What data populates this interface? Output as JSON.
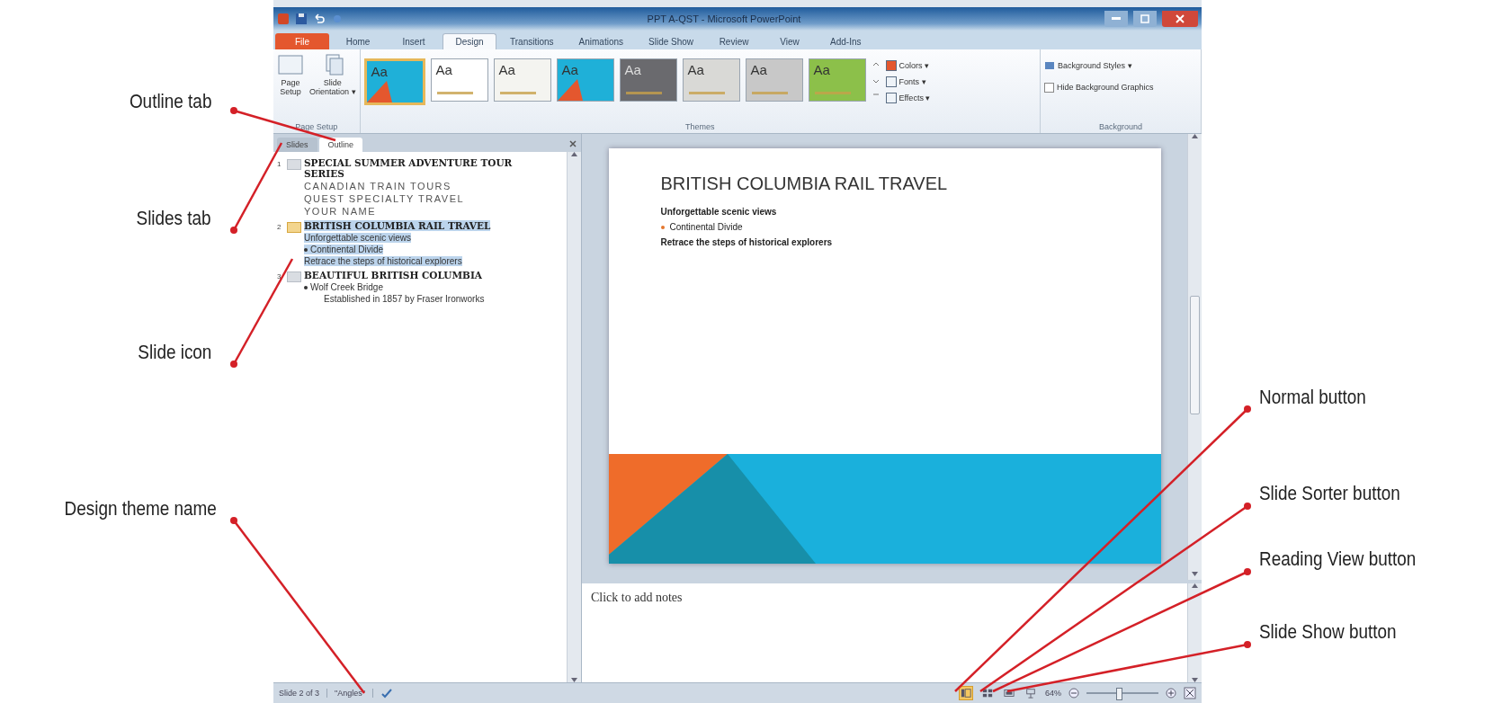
{
  "window": {
    "title": "PPT A-QST - Microsoft PowerPoint"
  },
  "ribbon_tabs": [
    {
      "label": "File",
      "selected": false,
      "kind": "file"
    },
    {
      "label": "Home",
      "selected": false,
      "kind": "tab"
    },
    {
      "label": "Insert",
      "selected": false,
      "kind": "tab"
    },
    {
      "label": "Design",
      "selected": true,
      "kind": "tab"
    },
    {
      "label": "Transitions",
      "selected": false,
      "kind": "tab"
    },
    {
      "label": "Animations",
      "selected": false,
      "kind": "tab"
    },
    {
      "label": "Slide Show",
      "selected": false,
      "kind": "tab"
    },
    {
      "label": "Review",
      "selected": false,
      "kind": "tab"
    },
    {
      "label": "View",
      "selected": false,
      "kind": "tab"
    },
    {
      "label": "Add-Ins",
      "selected": false,
      "kind": "tab"
    }
  ],
  "page_setup": {
    "buttons": [
      "Page\nSetup",
      "Slide\nOrientation ▾"
    ],
    "group": "Page Setup"
  },
  "themes": {
    "group": "Themes",
    "items": [
      {
        "label": "Aa",
        "selected": true,
        "color": "#1fb0d8"
      },
      {
        "label": "Aa",
        "selected": false,
        "color": "#ffffff"
      },
      {
        "label": "Aa",
        "selected": false,
        "color": "#f4f4f0"
      },
      {
        "label": "Aa",
        "selected": false,
        "color": "#1fb0d8"
      },
      {
        "label": "Aa",
        "selected": false,
        "color": "#6a6a6e"
      },
      {
        "label": "Aa",
        "selected": false,
        "color": "#d9d9d6"
      },
      {
        "label": "Aa",
        "selected": false,
        "color": "#c8c8c8"
      },
      {
        "label": "Aa",
        "selected": false,
        "color": "#8cc04a"
      }
    ],
    "options": [
      "Colors ▾",
      "Fonts ▾",
      "Effects ▾"
    ]
  },
  "background": {
    "group": "Background",
    "styles": "Background Styles ▾",
    "hide_graphics": {
      "label": "Hide Background Graphics",
      "checked": false
    }
  },
  "pane_tabs": [
    {
      "label": "Slides",
      "selected": false
    },
    {
      "label": "Outline",
      "selected": true
    }
  ],
  "outline": [
    {
      "number": "1",
      "title": "SPECIAL SUMMER ADVENTURE TOUR SERIES",
      "selected": false,
      "lines": [
        {
          "text": "CANADIAN TRAIN TOURS",
          "kind": "spaced"
        },
        {
          "text": "QUEST SPECIALTY TRAVEL",
          "kind": "spaced"
        },
        {
          "text": "YOUR NAME",
          "kind": "spaced"
        }
      ]
    },
    {
      "number": "2",
      "title": "BRITISH COLUMBIA RAIL TRAVEL",
      "selected": true,
      "lines": [
        {
          "text": "Unforgettable scenic views",
          "kind": "plain"
        },
        {
          "text": "Continental Divide",
          "kind": "bullet"
        },
        {
          "text": "Retrace the steps of historical explorers",
          "kind": "plain"
        }
      ]
    },
    {
      "number": "3",
      "title": "BEAUTIFUL BRITISH COLUMBIA",
      "selected": false,
      "lines": [
        {
          "text": "Wolf Creek Bridge",
          "kind": "bullet"
        },
        {
          "text": "Established in 1857 by Fraser Ironworks",
          "kind": "sub"
        }
      ]
    }
  ],
  "slide": {
    "title": "BRITISH COLUMBIA RAIL TRAVEL",
    "lines": [
      {
        "text": "Unforgettable scenic views",
        "kind": "plain"
      },
      {
        "text": "Continental Divide",
        "kind": "bullet"
      },
      {
        "text": "Retrace the steps of historical explorers",
        "kind": "plain"
      }
    ]
  },
  "notes": {
    "placeholder": "Click to add notes"
  },
  "status_bar": {
    "slide": "Slide 2 of 3",
    "theme": "\"Angles\"",
    "views": [
      {
        "kind": "normal",
        "selected": true
      },
      {
        "kind": "sorter",
        "selected": false
      },
      {
        "kind": "reading",
        "selected": false
      },
      {
        "kind": "show",
        "selected": false
      }
    ],
    "zoom": "64%",
    "zoom_level": {
      "level": 0.45
    }
  },
  "callouts": [
    {
      "label": "Outline tab"
    },
    {
      "label": "Slides tab"
    },
    {
      "label": "Slide icon"
    },
    {
      "label": "Design theme name"
    },
    {
      "label": "Normal button"
    },
    {
      "label": "Slide Sorter button"
    },
    {
      "label": "Reading View button"
    },
    {
      "label": "Slide Show button"
    }
  ]
}
